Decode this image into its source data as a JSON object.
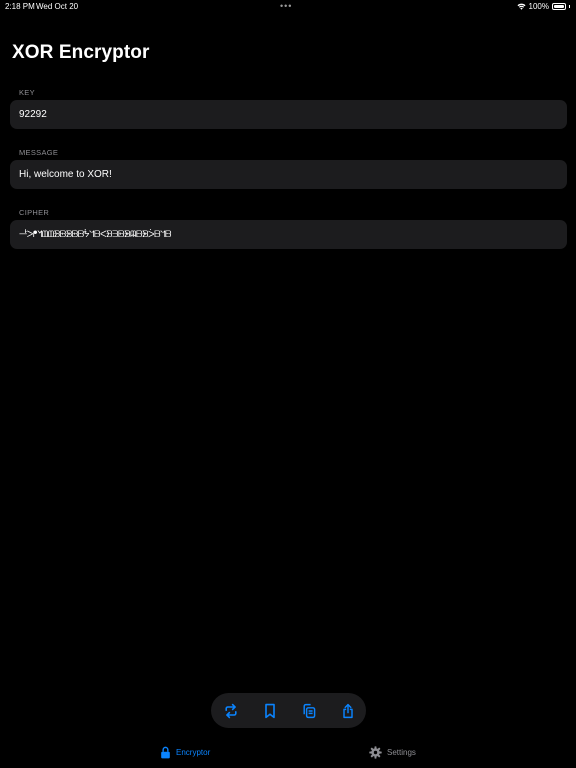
{
  "status_bar": {
    "time": "2:18 PM",
    "date": "Wed Oct 20",
    "dots": "•••",
    "battery_text": "100%",
    "battery_level": 1.0
  },
  "title": "XOR Encryptor",
  "fields": {
    "key": {
      "label": "KEY",
      "value": "92292"
    },
    "message": {
      "label": "MESSAGE",
      "value": "Hi, welcome to XOR!"
    },
    "cipher": {
      "label": "CIPHER",
      "value": "ᆣᐳᖰᖿᗶᗶᗿᗸᗾᗸᗹᖭᖻᗹᐸᗽᗱᗸᗾᗼᗹᗾᐴᗹᖻᗹ"
    }
  },
  "toolbar": {
    "icons": [
      "repeat-icon",
      "bookmark-icon",
      "copy-icon",
      "share-icon"
    ]
  },
  "tabs": {
    "encryptor": {
      "label": "Encryptor",
      "icon": "lock-icon"
    },
    "settings": {
      "label": "Settings",
      "icon": "gear-icon"
    }
  },
  "colors": {
    "accent": "#0a84ff",
    "background": "#000000",
    "field_bg": "#1c1c1e",
    "label_gray": "#8e8e93"
  }
}
